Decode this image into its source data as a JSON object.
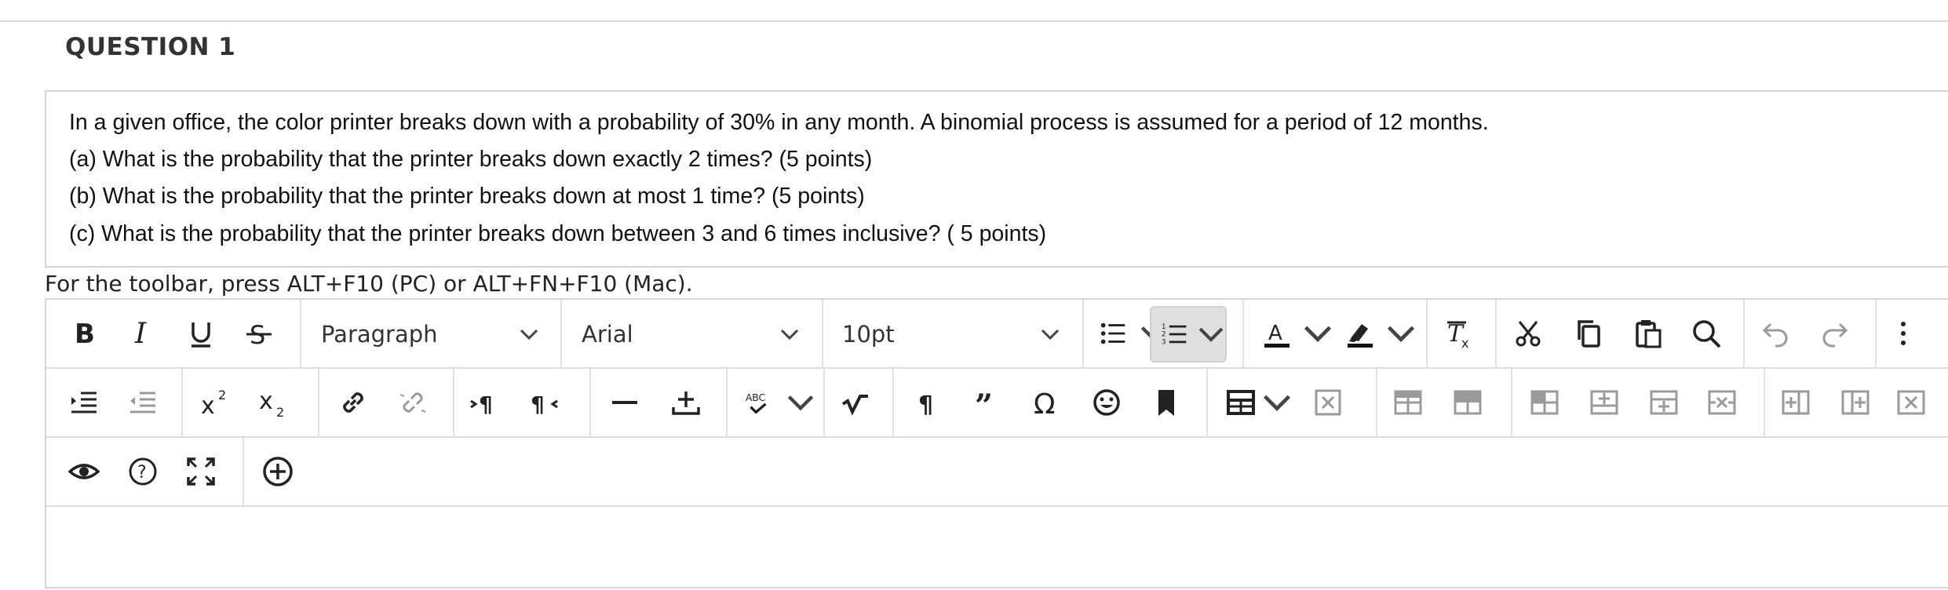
{
  "question": {
    "title": "QUESTION 1",
    "lines": [
      "In a given office, the color printer breaks down with a probability of 30% in any month. A binomial process is assumed for a period of 12 months.",
      "(a) What is the probability that the printer breaks down exactly 2 times?  (5 points)",
      "(b) What is the probability that the printer breaks down at most 1 time? (5 points)",
      "(c) What is the probability that the printer breaks down between 3 and 6 times inclusive? ( 5 points)"
    ]
  },
  "editor": {
    "toolbar_hint": "For the toolbar, press ALT+F10 (PC) or ALT+FN+F10 (Mac).",
    "block_format": "Paragraph",
    "font_family": "Arial",
    "font_size": "10pt",
    "spellcheck_label": "ABC",
    "colors": {
      "border": "#d6d6d6",
      "active_button": "#dfdfdf",
      "icon": "#222222",
      "disabled_icon": "#9a9a9a"
    }
  }
}
